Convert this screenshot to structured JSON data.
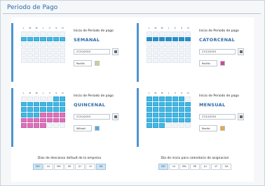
{
  "window": {
    "title": "Periodo de Pago"
  },
  "panels": [
    {
      "label": "Inicio de Periodo de pago",
      "kind": "SEMANAL",
      "date": "27/12/2015",
      "color_name": "Rodillo",
      "color_hex": "#c6d48a",
      "weekday_headers": [
        "L",
        "M",
        "M",
        "J",
        "V",
        "S",
        "D"
      ],
      "cal_state": [
        "empty",
        "blue",
        "empty",
        "empty",
        "empty",
        "empty"
      ]
    },
    {
      "label": "Inicio de Periodo de pago",
      "kind": "CATORCENAL",
      "date": "27/12/2015",
      "color_name": "Rodillo",
      "color_hex": "#d1479a",
      "weekday_headers": [
        "L",
        "M",
        "M",
        "J",
        "V",
        "S",
        "D"
      ],
      "cal_state": [
        "empty",
        "dark",
        "empty",
        "empty",
        "empty",
        "empty"
      ]
    },
    {
      "label": "Inicio de Periodo de pago",
      "kind": "QUINCENAL",
      "date": "27/12/2015",
      "color_name": "Willwell",
      "color_hex": "#56a9df",
      "weekday_headers": [
        "L",
        "M",
        "M",
        "J",
        "V",
        "S",
        "D"
      ],
      "cal_state": [
        "split"
      ]
    },
    {
      "label": "Inicio de Periodo de pago",
      "kind": "MENSUAL",
      "date": "27/12/2015",
      "color_name": "Realist",
      "color_hex": "#f0a53b",
      "weekday_headers": [
        "L",
        "M",
        "M",
        "J",
        "V",
        "S",
        "D"
      ],
      "cal_state": [
        "full"
      ]
    }
  ],
  "bottom": [
    {
      "head": "Dias de descanso default de la empresa",
      "days": [
        "DO",
        "LU",
        "MA",
        "MI",
        "JU",
        "VI",
        "SA"
      ],
      "selected": [
        "DO",
        "SA"
      ]
    },
    {
      "head": "Dia de inicio para calendario de asignacion",
      "days": [
        "DO",
        "LU",
        "MA",
        "MI",
        "JU",
        "VI",
        "SA"
      ],
      "selected": [
        "DO"
      ]
    }
  ]
}
